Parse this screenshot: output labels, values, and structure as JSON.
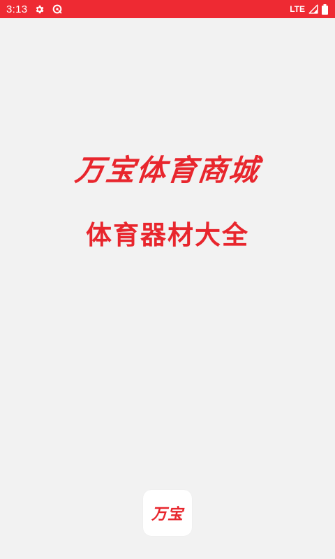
{
  "status_bar": {
    "time": "3:13",
    "network": "LTE",
    "icons": [
      "settings-gear-icon",
      "data-saver-icon",
      "signal-icon",
      "battery-icon"
    ],
    "color": "#ee2a33"
  },
  "splash": {
    "title": "万宝体育商城",
    "subtitle": "体育器材大全",
    "accent_color": "#e8262d",
    "background_color": "#f2f2f2"
  },
  "logo": {
    "text": "万宝"
  }
}
